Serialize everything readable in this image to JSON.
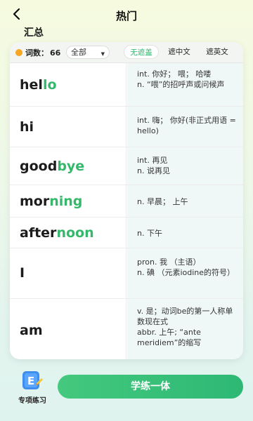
{
  "header": {
    "title": "热门"
  },
  "section": {
    "title": "汇总"
  },
  "toolbar": {
    "count_label": "词数：",
    "count_value": "66",
    "filter_selected": "全部",
    "tabs": [
      {
        "label": "无遮盖",
        "active": true
      },
      {
        "label": "遮中文",
        "active": false
      },
      {
        "label": "遮英文",
        "active": false
      }
    ]
  },
  "words": [
    {
      "prefix": "hel",
      "highlight": "lo",
      "definition": "int. 你好； 喂； 哈喽\nn. “喂”的招呼声或问候声"
    },
    {
      "prefix": "hi",
      "highlight": "",
      "definition": "int. 嗨； 你好(非正式用语 = hello)"
    },
    {
      "prefix": "good",
      "highlight": "bye",
      "definition": "int. 再见\n n. 说再见"
    },
    {
      "prefix": "mor",
      "highlight": "ning",
      "definition": "n. 早晨； 上午"
    },
    {
      "prefix": "after",
      "highlight": "noon",
      "definition": "n. 下午"
    },
    {
      "prefix": "I",
      "highlight": "",
      "definition": "pron. 我 （主语）\nn. 碘 （元素iodine的符号）"
    },
    {
      "prefix": "am",
      "highlight": "",
      "definition": "v. 是；动词be的第一人称单数现在式\n abbr. 上午; “ante meridiem”的缩写"
    }
  ],
  "bottom": {
    "practice_label": "专项练习",
    "main_button": "学练一体"
  },
  "colors": {
    "accent": "#2fb66d",
    "highlight": "#35b86b",
    "def_bg": "#f0f8f7",
    "count_dot": "#f5a623"
  }
}
